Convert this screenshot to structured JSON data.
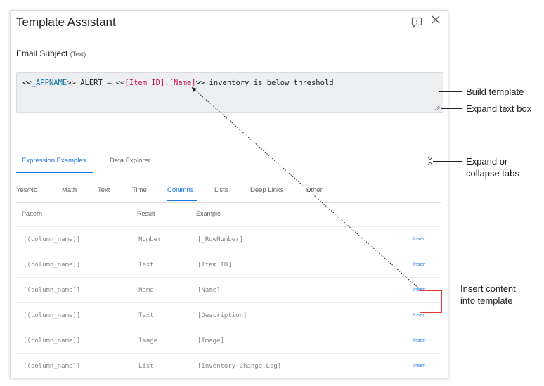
{
  "dialog": {
    "title": "Template Assistant",
    "field_label": "Email Subject",
    "field_type": "(Text)"
  },
  "template": {
    "t1": "<<",
    "t2": "_APPNAME",
    "t3": ">> ALERT – <<",
    "t4": "[Item ID]",
    "t5": ".",
    "t6": "[Name]",
    "t7": ">> inventory is below threshold"
  },
  "tabs": {
    "expression_examples": "Expression Examples",
    "data_explorer": "Data Explorer"
  },
  "subtabs": [
    "Yes/No",
    "Math",
    "Text",
    "Time",
    "Columns",
    "Lists",
    "Deep Links",
    "Other"
  ],
  "active_subtab": "Columns",
  "table": {
    "headers": {
      "pattern": "Pattern",
      "result": "Result",
      "example": "Example"
    },
    "insert_label": "Insert",
    "rows": [
      {
        "pattern": "[(column_name)]",
        "result": "Number",
        "example": "[_RowNumber]"
      },
      {
        "pattern": "[(column_name)]",
        "result": "Text",
        "example": "[Item ID]"
      },
      {
        "pattern": "[(column_name)]",
        "result": "Name",
        "example": "[Name]"
      },
      {
        "pattern": "[(column_name)]",
        "result": "Text",
        "example": "[Description]"
      },
      {
        "pattern": "[(column_name)]",
        "result": "Image",
        "example": "[Image]"
      },
      {
        "pattern": "[(column_name)]",
        "result": "List",
        "example": "[Inventory Change Log]"
      }
    ]
  },
  "callouts": {
    "build_template": "Build template",
    "expand_text_box": "Expand text box",
    "expand_tabs_1": "Expand or",
    "expand_tabs_2": "collapse tabs",
    "insert_1": "Insert content",
    "insert_2": "into template"
  },
  "colors": {
    "accent": "#1a73e8",
    "highlight": "#e53935",
    "token_pink": "#c2185b",
    "token_blue": "#1a73a8"
  }
}
